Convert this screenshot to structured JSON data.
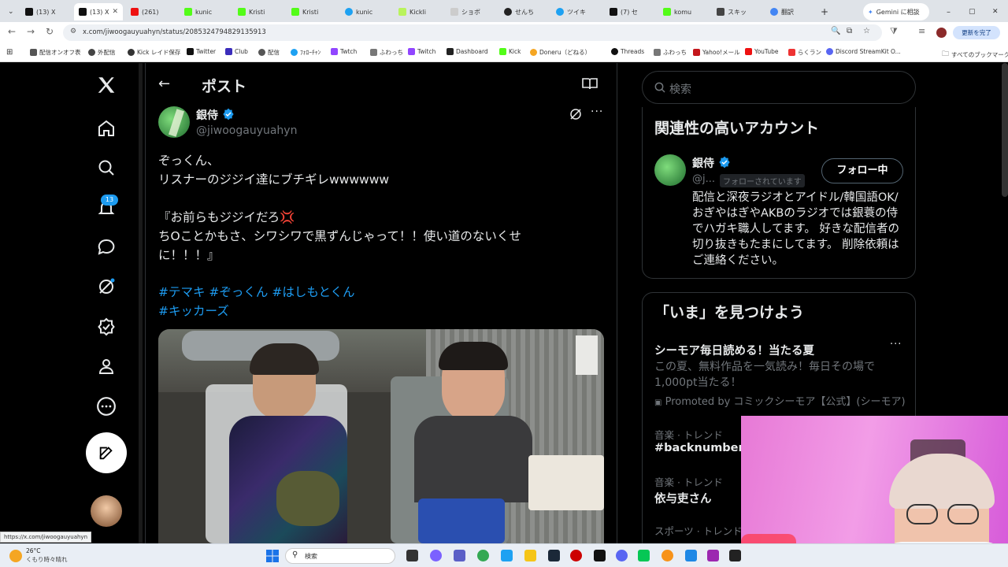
{
  "browser": {
    "tabs": [
      {
        "label": "(13) X"
      },
      {
        "label": "(13) X"
      },
      {
        "label": "(261)"
      },
      {
        "label": "kunic"
      },
      {
        "label": "Kristi"
      },
      {
        "label": "Kristi"
      },
      {
        "label": "kunic"
      },
      {
        "label": "Kickli"
      },
      {
        "label": "ショボ"
      },
      {
        "label": "せんち"
      },
      {
        "label": "ツイキ"
      },
      {
        "label": "(7) セ"
      },
      {
        "label": "komu"
      },
      {
        "label": "スキッ"
      },
      {
        "label": "翻訳"
      }
    ],
    "gemini_button": "Gemini に相談",
    "url": "x.com/jiwoogauyuahyn/status/2085324794829135913",
    "update_button": "更新を完了",
    "bookmarks": [
      "配信オンオフ表",
      "外配信",
      "Kick レイド保存",
      "Twitter",
      "Club",
      "配信",
      "ﾌｫﾛｰﾁｬﾝ",
      "Twtch",
      "ふわっち",
      "Twitch",
      "Dashboard",
      "Kick",
      "Doneru（どねる）",
      "...",
      "Threads",
      "ふわっち",
      "Yahoo!メール",
      "YouTube",
      "らくラン",
      "Discord StreamKit O..."
    ],
    "all_bookmarks": "すべてのブックマーク",
    "status_url": "https://x.com/jiwoogauyuahyn"
  },
  "sidebar": {
    "notification_count": "13"
  },
  "post": {
    "header_title": "ポスト",
    "author_name": "銀侍",
    "author_handle": "@jiwoogauyuahyn",
    "lines": [
      "ぞっくん、",
      "リスナーのジジイ達にブチギレwwwwww",
      "",
      "『お前らもジジイだろ💢",
      "ちOことかもさ、シワシワで黒ずんじゃって！！使い道のないくせ",
      "に！！！』"
    ],
    "hashtags_line1": "#テマキ #ぞっくん #はしもとくん",
    "hashtags_line2": "#キッカーズ"
  },
  "right": {
    "search_placeholder": "検索",
    "related_title": "関連性の高いアカウント",
    "related_name": "銀侍",
    "related_handle": "@j...",
    "follows_you": "フォローされています",
    "follow_button": "フォロー中",
    "bio": "配信と深夜ラジオとアイドル/韓国語OK/おぎやはぎやAKBのラジオでは銀蓑の侍でハガキ職人してます。 好きな配信者の切り抜きもたまにしてます。 削除依頼はご連絡ください。",
    "trends_title": "「いま」を見つけよう",
    "promo_title": "シーモア毎日読める！当たる夏",
    "promo_text": "この夏、無料作品を一気読み！毎日その場で1,000pt当たる！",
    "promo_by": "Promoted by コミックシーモア【公式】(シーモア)",
    "trend1_cat": "音楽 · トレンド",
    "trend1_name": "#backnumber",
    "trend2_cat": "音楽 · トレンド",
    "trend2_name": "依与吏さん",
    "trend3_cat": "スポーツ · トレンド"
  },
  "taskbar": {
    "weather_temp": "26°C",
    "weather_text": "くもり時々晴れ",
    "search_label": "検索"
  },
  "colors": {
    "accent": "#1d9bf0",
    "background": "#000000",
    "text": "#e7e9ea",
    "muted": "#71767b"
  }
}
